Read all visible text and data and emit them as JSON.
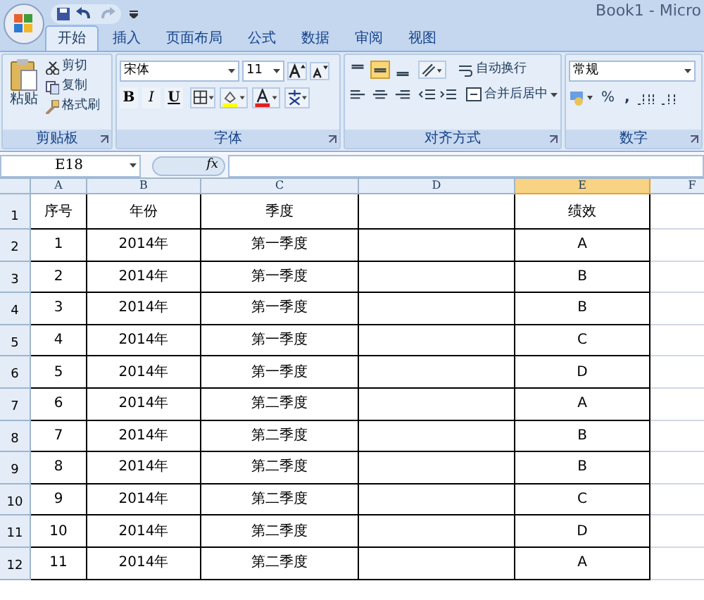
{
  "window": {
    "title": "Book1 - Micro"
  },
  "tabs": [
    {
      "label": "开始",
      "selected": true
    },
    {
      "label": "插入",
      "selected": false
    },
    {
      "label": "页面布局",
      "selected": false
    },
    {
      "label": "公式",
      "selected": false
    },
    {
      "label": "数据",
      "selected": false
    },
    {
      "label": "审阅",
      "selected": false
    },
    {
      "label": "视图",
      "selected": false
    }
  ],
  "clipboard": {
    "paste": "粘贴",
    "items": [
      "剪切",
      "复制",
      "格式刷"
    ],
    "group": "剪贴板"
  },
  "font": {
    "name": "宋体",
    "size": "11",
    "bold": "B",
    "italic": "I",
    "underline": "U",
    "group": "字体"
  },
  "alignment": {
    "vertical": [
      {
        "selected": false
      },
      {
        "selected": true
      },
      {
        "selected": false
      }
    ],
    "wrap": "自动换行",
    "merge": "合并后居中",
    "group": "对齐方式"
  },
  "number": {
    "format": "常规",
    "percent": "%",
    "comma": ",",
    "group": "数字"
  },
  "formula_bar": {
    "name_box": "E18",
    "fx": "fx"
  },
  "columns": [
    {
      "label": "A",
      "selected": false
    },
    {
      "label": "B",
      "selected": false
    },
    {
      "label": "C",
      "selected": false
    },
    {
      "label": "D",
      "selected": false
    },
    {
      "label": "E",
      "selected": true
    },
    {
      "label": "F",
      "selected": false
    }
  ],
  "rows": [
    {
      "number": "1",
      "cells": [
        "序号",
        "年份",
        "季度",
        "",
        "绩效"
      ]
    },
    {
      "number": "2",
      "cells": [
        "1",
        "2014年",
        "第一季度",
        "",
        "A"
      ]
    },
    {
      "number": "3",
      "cells": [
        "2",
        "2014年",
        "第一季度",
        "",
        "B"
      ]
    },
    {
      "number": "4",
      "cells": [
        "3",
        "2014年",
        "第一季度",
        "",
        "B"
      ]
    },
    {
      "number": "5",
      "cells": [
        "4",
        "2014年",
        "第一季度",
        "",
        "C"
      ]
    },
    {
      "number": "6",
      "cells": [
        "5",
        "2014年",
        "第一季度",
        "",
        "D"
      ]
    },
    {
      "number": "7",
      "cells": [
        "6",
        "2014年",
        "第二季度",
        "",
        "A"
      ]
    },
    {
      "number": "8",
      "cells": [
        "7",
        "2014年",
        "第二季度",
        "",
        "B"
      ]
    },
    {
      "number": "9",
      "cells": [
        "8",
        "2014年",
        "第二季度",
        "",
        "B"
      ]
    },
    {
      "number": "10",
      "cells": [
        "9",
        "2014年",
        "第二季度",
        "",
        "C"
      ]
    },
    {
      "number": "11",
      "cells": [
        "10",
        "2014年",
        "第二季度",
        "",
        "D"
      ]
    },
    {
      "number": "12",
      "cells": [
        "11",
        "2014年",
        "第二季度",
        "",
        "A"
      ]
    }
  ]
}
